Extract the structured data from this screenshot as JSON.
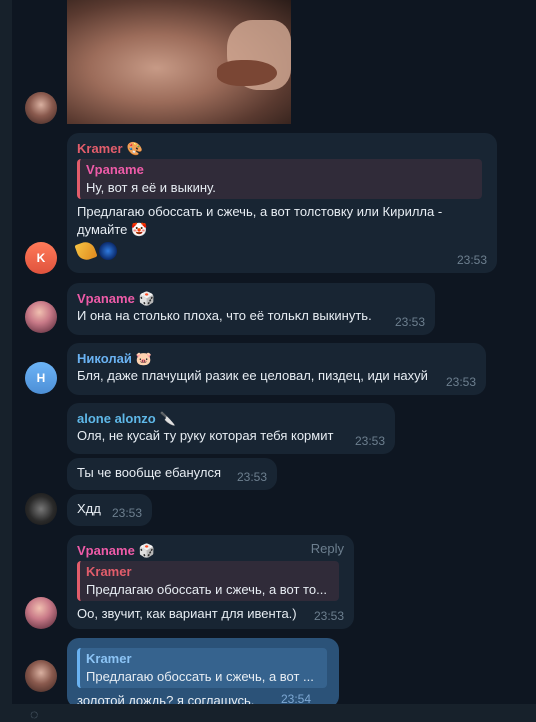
{
  "messages": [
    {
      "sender": "Kramer",
      "sender_color": "#e25d6b",
      "sender_icon": "🎨",
      "reply": {
        "name": "Vpaname",
        "text": "Ну, вот я её и выкину."
      },
      "text_lines": [
        "Предлагаю обоссать и сжечь, а вот толстовку или Кирилла -",
        "думайте"
      ],
      "text_emoji": "🤡",
      "time": "23:53",
      "avatar_letter": "K"
    },
    {
      "sender": "Vpaname",
      "sender_color": "#ee5ba8",
      "sender_icon": "🎲",
      "text": "И она на столько плоха, что её тольκл выкинуть.",
      "time": "23:53"
    },
    {
      "sender": "Николай",
      "sender_color": "#6ab2f2",
      "sender_icon": "🐷",
      "text": "Бля, даже плачущий разик ее целовал, пиздец, иди нахуй",
      "time": "23:53",
      "avatar_letter": "Н"
    },
    {
      "sender": "alone alonzo",
      "sender_color": "#5fb8e8",
      "sender_icon": "🔪",
      "text": "Оля, не кусай ту руку которая тебя кормит",
      "time": "23:53"
    },
    {
      "text": "Ты че вообще ебанулся",
      "time": "23:53"
    },
    {
      "text": "Хдд",
      "time": "23:53"
    },
    {
      "sender": "Vpaname",
      "sender_color": "#ee5ba8",
      "sender_icon": "🎲",
      "action": "Reply",
      "reply": {
        "name": "Kramer",
        "text": "Предлагаю обоссать и сжечь, а вот то..."
      },
      "text": "Оо, звучит, как вариант для ивента.)",
      "time": "23:53"
    },
    {
      "reply": {
        "name": "Kramer",
        "text": "Предлагаю обоссать и сжечь, а вот ..."
      },
      "text": "золотой дождь?  я соглашусь.",
      "time": "23:54"
    }
  ]
}
